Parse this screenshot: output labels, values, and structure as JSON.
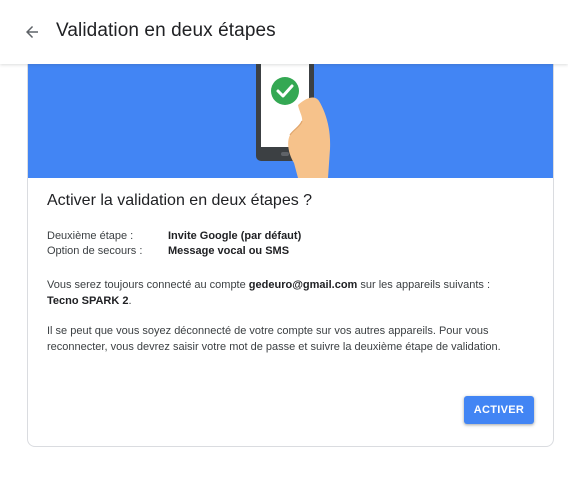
{
  "header": {
    "title": "Validation en deux étapes",
    "back_icon": "arrow-back-icon"
  },
  "card": {
    "illustration_icon": "phone-check-icon",
    "colors": {
      "hero_bg": "#4285f4",
      "check": "#34a853",
      "button": "#4285f4"
    },
    "heading": "Activer la validation en deux étapes ?",
    "rows": [
      {
        "label": "Deuxième étape :",
        "value": "Invite Google (par défaut)"
      },
      {
        "label": "Option de secours :",
        "value": "Message vocal ou SMS"
      }
    ],
    "paragraph1": {
      "prefix": "Vous serez toujours connecté au compte ",
      "email": "gedeuro@gmail.com",
      "suffix": " sur les appareils suivants :",
      "device": "Tecno SPARK 2",
      "end": "."
    },
    "paragraph2": "Il se peut que vous soyez déconnecté de votre compte sur vos autres appareils. Pour vous reconnecter, vous devrez saisir votre mot de passe et suivre la deuxième étape de validation.",
    "activate_label": "ACTIVER"
  }
}
